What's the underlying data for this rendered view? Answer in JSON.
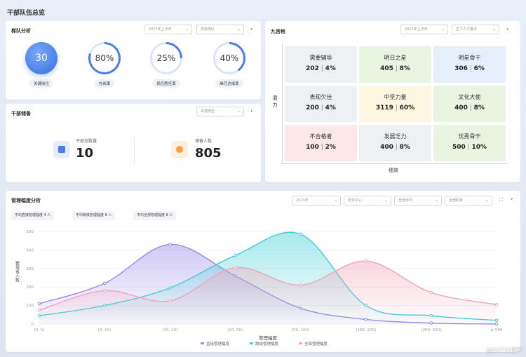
{
  "page": {
    "title": "干部队伍总览"
  },
  "team_analysis": {
    "title": "梯队分析",
    "select1": "2023年上半年",
    "select2": "高级梯队",
    "rings": [
      {
        "value": "30",
        "label": "关键岗位",
        "percent": 100,
        "filled": true
      },
      {
        "value": "80%",
        "label": "在岗率",
        "percent": 80,
        "filled": false
      },
      {
        "value": "25%",
        "label": "现任胜任率",
        "percent": 25,
        "filled": false
      },
      {
        "value": "40%",
        "label": "继任达成率",
        "percent": 40,
        "filled": false
      }
    ]
  },
  "reserve": {
    "title": "干部储备",
    "select": "高潜类型",
    "items": [
      {
        "label": "干部池数量",
        "value": "10",
        "icon": "document-icon",
        "color": "#4a7fe6"
      },
      {
        "label": "储备人数",
        "value": "805",
        "icon": "person-icon",
        "color": "#f5a14a"
      }
    ]
  },
  "nine_grid": {
    "title": "九宫格",
    "select1": "2023年上半年",
    "select2": "正工人才盘点",
    "y_label": "潜力",
    "x_label": "绩效",
    "cells": [
      {
        "title": "需要辅导",
        "count": "202",
        "pct": "4%",
        "color": "#eef0f3"
      },
      {
        "title": "明日之星",
        "count": "405",
        "pct": "8%",
        "color": "#e9f5e1"
      },
      {
        "title": "明星骨干",
        "count": "306",
        "pct": "6%",
        "color": "#e5f0fc"
      },
      {
        "title": "表现欠佳",
        "count": "200",
        "pct": "4%",
        "color": "#eef0f3"
      },
      {
        "title": "中坚力量",
        "count": "3119",
        "pct": "60%",
        "color": "#fdf6e1"
      },
      {
        "title": "文化大使",
        "count": "400",
        "pct": "8%",
        "color": "#e9f5e1"
      },
      {
        "title": "不合格者",
        "count": "100",
        "pct": "2%",
        "color": "#fbe7e7"
      },
      {
        "title": "发展乏力",
        "count": "400",
        "pct": "8%",
        "color": "#eef0f3"
      },
      {
        "title": "优秀骨干",
        "count": "500",
        "pct": "10%",
        "color": "#e9f5e1"
      }
    ]
  },
  "span_analysis": {
    "title": "管理幅度分析",
    "selects": [
      "2023年",
      "研发中心",
      "全部序列",
      "全部职级"
    ],
    "chips": [
      "平均直接管理幅度 4 人",
      "平均跨级管理幅度 8 人",
      "平均全部管理幅度 8 人"
    ],
    "ylabel": "管理者人数",
    "xlabel": "管理幅度"
  },
  "chart_data": {
    "type": "area",
    "categories": [
      "[0, 5)",
      "[5, 10)",
      "[10, 20)",
      "[20, 50)",
      "[50, 100)",
      "[100, 200)",
      "[200, 500)",
      "≥ 500"
    ],
    "ylim": [
      0,
      500
    ],
    "yticks": [
      0,
      100,
      200,
      300,
      400,
      500
    ],
    "series": [
      {
        "name": "直接管理幅度",
        "color": "#9b87e8",
        "values": [
          110,
          220,
          430,
          260,
          85,
          25,
          5,
          0
        ]
      },
      {
        "name": "跨级管理幅度",
        "color": "#3fcfd6",
        "values": [
          45,
          100,
          195,
          370,
          485,
          100,
          45,
          20
        ]
      },
      {
        "name": "全部管理幅度",
        "color": "#f2a3b8",
        "values": [
          75,
          180,
          125,
          305,
          210,
          340,
          170,
          105
        ]
      }
    ],
    "legend_position": "bottom",
    "grid": true
  },
  "watermark": "@51CTO博客"
}
